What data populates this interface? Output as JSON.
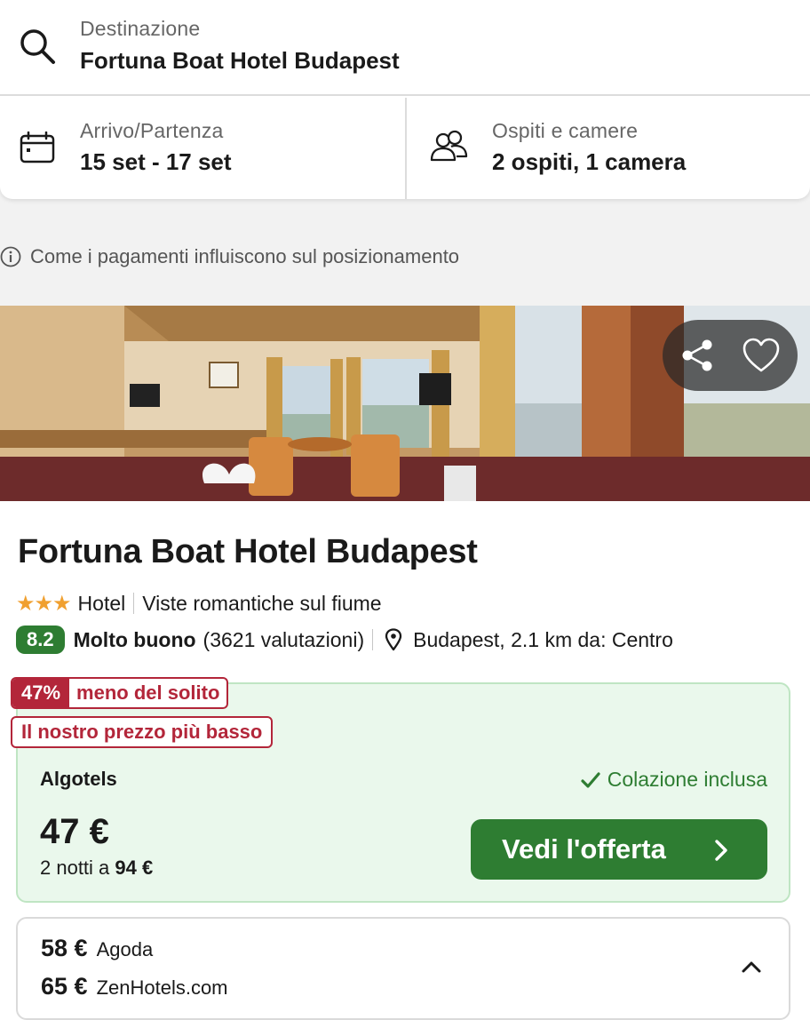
{
  "search": {
    "destination_label": "Destinazione",
    "destination_value": "Fortuna Boat Hotel Budapest",
    "dates_label": "Arrivo/Partenza",
    "dates_value": "15 set - 17 set",
    "guests_label": "Ospiti e camere",
    "guests_value": "2 ospiti, 1 camera"
  },
  "info_notice": "Come i pagamenti influiscono sul posizionamento",
  "hotel": {
    "name": "Fortuna Boat Hotel Budapest",
    "stars": "★★★",
    "star_count": 3,
    "type": "Hotel",
    "feature": "Viste romantiche sul fiume",
    "score": "8.2",
    "rating_word": "Molto buono",
    "reviews": "(3621 valutazioni)",
    "location": "Budapest, 2.1 km da: Centro"
  },
  "deal": {
    "discount_pct": "47%",
    "discount_text": "meno del solito",
    "lowest_badge": "Il nostro prezzo più basso",
    "provider": "Algotels",
    "breakfast": "Colazione inclusa",
    "price": "47 €",
    "nights_prefix": "2 notti a ",
    "nights_total": "94 €",
    "cta_label": "Vedi l'offerta"
  },
  "alternatives": [
    {
      "price": "58 €",
      "provider": "Agoda"
    },
    {
      "price": "65 €",
      "provider": "ZenHotels.com"
    }
  ],
  "colors": {
    "green": "#2e7d32",
    "deal_bg": "#eaf8ec",
    "badge_red": "#b3263a",
    "star_orange": "#f0a030"
  },
  "icons": [
    "search-icon",
    "calendar-icon",
    "guests-icon",
    "info-icon",
    "share-icon",
    "heart-icon",
    "star-icon",
    "location-pin-icon",
    "check-icon",
    "chevron-right-icon",
    "chevron-up-icon"
  ]
}
